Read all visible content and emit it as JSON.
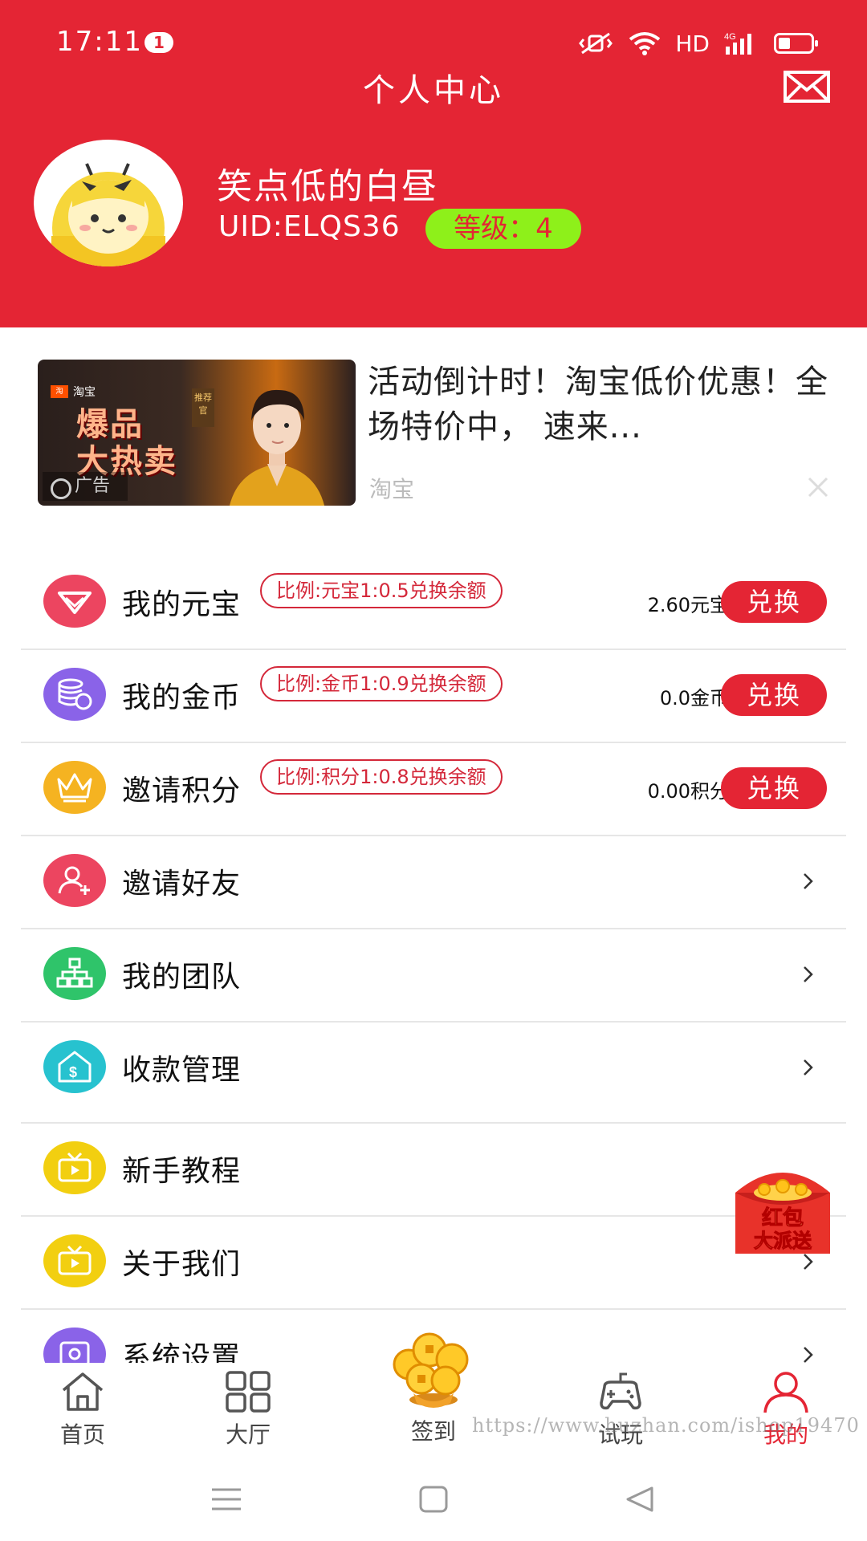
{
  "status_bar": {
    "time": "17:11",
    "notification_count": "1",
    "network_label": "HD"
  },
  "header": {
    "title": "个人中心",
    "username": "笑点低的白昼",
    "uid": "UID:ELQS36",
    "level": "等级：4"
  },
  "ad": {
    "image_brand": "淘宝",
    "image_headline_1": "爆品",
    "image_headline_2": "大热卖",
    "image_tag": "推荐官",
    "ad_label": "广告",
    "title": "活动倒计时！淘宝低价优惠！全场特价中， 速来...",
    "source": "淘宝"
  },
  "wallet_rows": [
    {
      "label": "我的元宝",
      "ratio": "比例:元宝1:0.5兑换余额",
      "amount": "2.60元宝",
      "button": "兑换",
      "icon": "ingot-icon",
      "color": "#ec4560"
    },
    {
      "label": "我的金币",
      "ratio": "比例:金币1:0.9兑换余额",
      "amount": "0.0金币",
      "button": "兑换",
      "icon": "coin-stack-icon",
      "color": "#8a63e8"
    },
    {
      "label": "邀请积分",
      "ratio": "比例:积分1:0.8兑换余额",
      "amount": "0.00积分",
      "button": "兑换",
      "icon": "crown-icon",
      "color": "#f5b321"
    }
  ],
  "menu_rows": [
    {
      "label": "邀请好友",
      "icon": "add-user-icon",
      "color": "#ec4560"
    },
    {
      "label": "我的团队",
      "icon": "team-tree-icon",
      "color": "#2fc46a"
    },
    {
      "label": "收款管理",
      "icon": "money-house-icon",
      "color": "#27c2cf"
    },
    {
      "label": "新手教程",
      "icon": "tv-play-icon",
      "color": "#f2cf10"
    },
    {
      "label": "关于我们",
      "icon": "tv-play-icon",
      "color": "#f2cf10"
    },
    {
      "label": "系统设置",
      "icon": "settings-icon",
      "color": "#8a63e8"
    }
  ],
  "red_packet": {
    "line1": "红包",
    "line2": "大派送"
  },
  "bottom_nav": [
    {
      "label": "首页",
      "icon": "home-icon"
    },
    {
      "label": "大厅",
      "icon": "grid-icon"
    },
    {
      "label": "签到",
      "icon": "coin-pile-icon"
    },
    {
      "label": "试玩",
      "icon": "gamepad-icon"
    },
    {
      "label": "我的",
      "icon": "user-icon",
      "active": true
    }
  ],
  "watermark": "https://www.huzhan.com/ishop19470",
  "colors": {
    "primary": "#e42534",
    "level_badge": "#8ef01a",
    "divider": "#e6e6e6"
  }
}
